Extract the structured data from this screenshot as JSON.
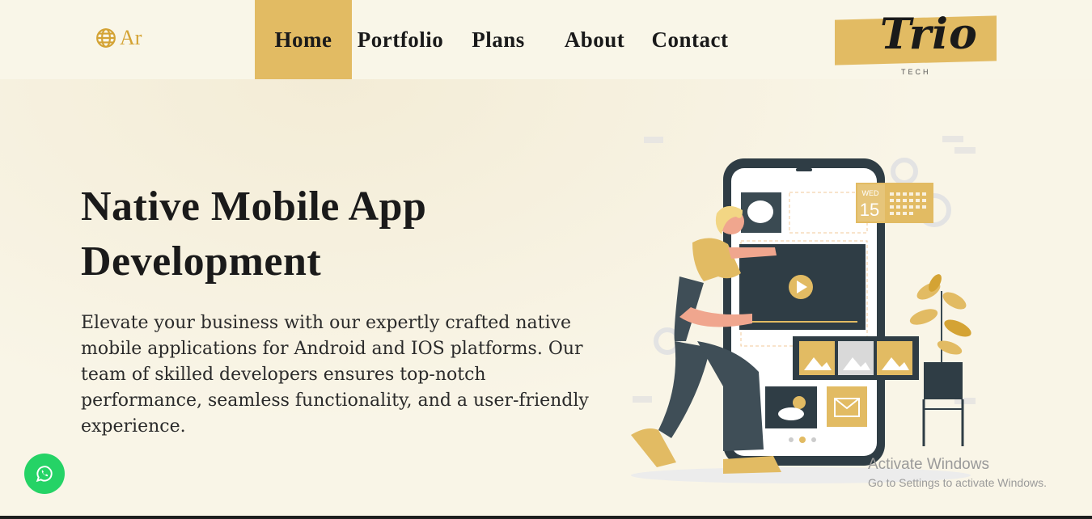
{
  "header": {
    "language": "Ar",
    "nav": [
      {
        "label": "Home",
        "active": true
      },
      {
        "label": "Portfolio",
        "active": false
      },
      {
        "label": "Plans",
        "active": false
      },
      {
        "label": "About",
        "active": false
      },
      {
        "label": "Contact",
        "active": false
      }
    ],
    "logo": {
      "text": "Trio",
      "sub": "TECH"
    }
  },
  "hero": {
    "title_line1": "Native Mobile App",
    "title_line2": "Development",
    "description": "Elevate your business with our expertly crafted native mobile applications for Android and IOS platforms. Our team of skilled developers ensures top-notch performance, seamless functionality, and a user-friendly experience."
  },
  "illustration": {
    "calendar_day": "WED",
    "calendar_date": "15"
  },
  "system": {
    "watermark_title": "Activate Windows",
    "watermark_sub": "Go to Settings to activate Windows."
  },
  "colors": {
    "accent": "#e2bb63",
    "background": "#f9f5e7",
    "whatsapp": "#25d366"
  },
  "icons": [
    "globe-icon",
    "whatsapp-icon",
    "play-icon",
    "image-icon",
    "mail-icon",
    "calendar-icon"
  ]
}
